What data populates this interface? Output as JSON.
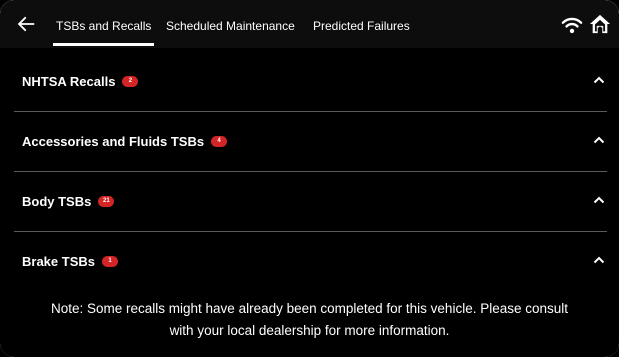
{
  "header": {
    "back_icon": "arrow-left-icon",
    "tabs": [
      {
        "label": "TSBs and Recalls",
        "active": true
      },
      {
        "label": "Scheduled Maintenance",
        "active": false
      },
      {
        "label": "Predicted Failures",
        "active": false
      }
    ],
    "wifi_icon": "wifi-icon",
    "home_icon": "home-icon"
  },
  "sections": [
    {
      "title": "NHTSA Recalls",
      "badge": "2",
      "expanded": true
    },
    {
      "title": "Accessories and Fluids TSBs",
      "badge": "4",
      "expanded": true
    },
    {
      "title": "Body TSBs",
      "badge": "21",
      "expanded": true
    },
    {
      "title": "Brake TSBs",
      "badge": "1",
      "expanded": true
    }
  ],
  "note": {
    "line1": "Note: Some recalls might have already been completed for this vehicle. Please consult",
    "line2": "with your local dealership for more information."
  },
  "colors": {
    "background": "#000000",
    "topbar": "#0d0d0d",
    "badge": "#d32426",
    "text": "#ffffff",
    "divider": "#5a5a5a"
  }
}
